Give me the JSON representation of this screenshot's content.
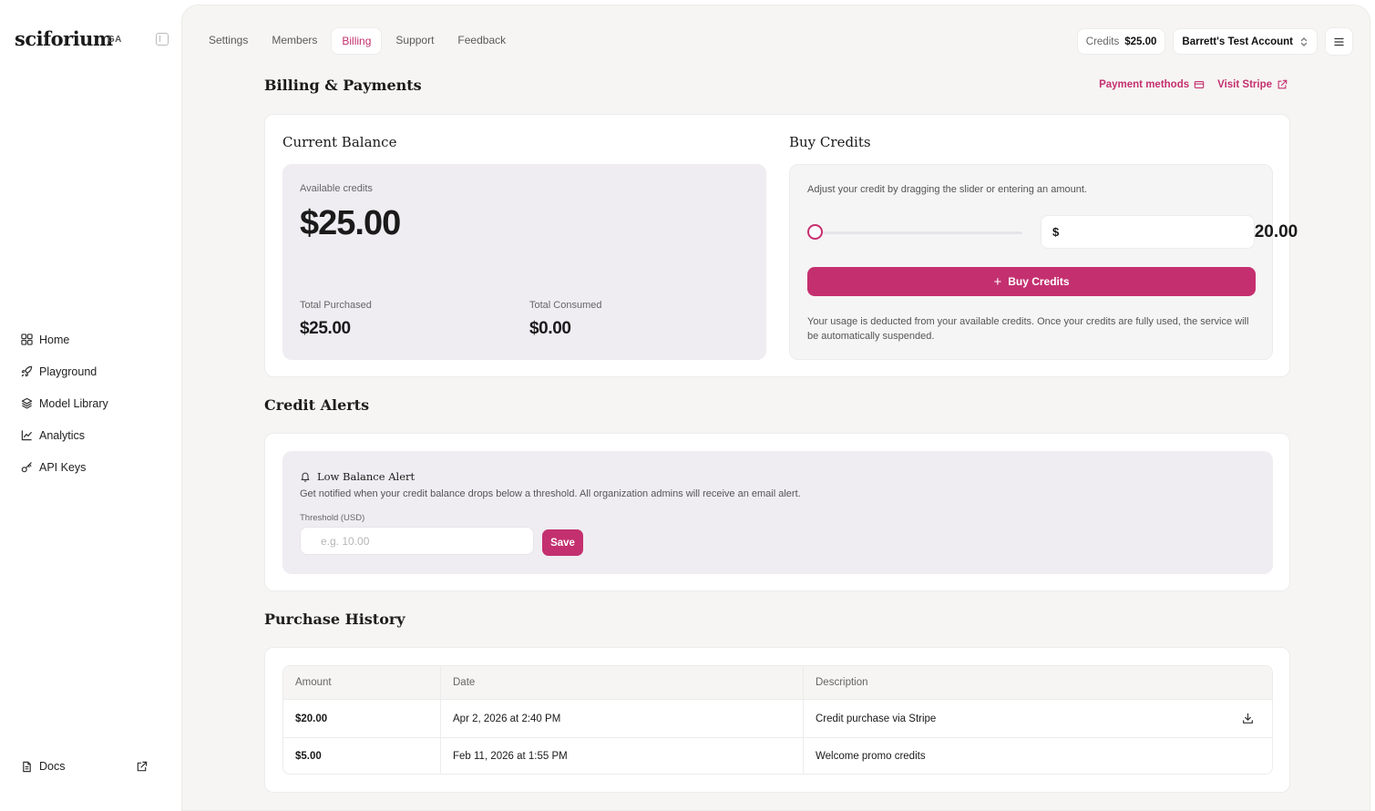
{
  "sidebar": {
    "brand": "sciforium",
    "brand_tag": "GA",
    "items": [
      {
        "label": "Home",
        "icon": "grid-icon"
      },
      {
        "label": "Playground",
        "icon": "rocket-icon"
      },
      {
        "label": "Model Library",
        "icon": "layers-icon"
      },
      {
        "label": "Analytics",
        "icon": "chart-line-icon"
      },
      {
        "label": "API Keys",
        "icon": "key-icon"
      }
    ],
    "docs": "Docs"
  },
  "topbar": {
    "tabs": [
      {
        "label": "Settings",
        "active": false
      },
      {
        "label": "Members",
        "active": false
      },
      {
        "label": "Billing",
        "active": true
      },
      {
        "label": "Support",
        "active": false
      },
      {
        "label": "Feedback",
        "active": false
      }
    ],
    "credits_label": "Credits",
    "credits_value": "$25.00",
    "account": "Barrett's Test Account"
  },
  "page": {
    "title": "Billing & Payments",
    "payment_methods": "Payment methods",
    "visit_stripe": "Visit Stripe"
  },
  "balance": {
    "title": "Current Balance",
    "available_label": "Available credits",
    "available_value": "$25.00",
    "purchased_label": "Total Purchased",
    "purchased_value": "$25.00",
    "consumed_label": "Total Consumed",
    "consumed_value": "$0.00"
  },
  "buy": {
    "title": "Buy Credits",
    "description": "Adjust your credit by dragging the slider or entering an amount.",
    "currency": "$",
    "amount": "20.00",
    "slider_fraction": 0,
    "button": "Buy Credits",
    "note": "Your usage is deducted from your available credits. Once your credits are fully used, the service will be automatically suspended."
  },
  "alerts": {
    "section_title": "Credit Alerts",
    "title": "Low Balance Alert",
    "description": "Get notified when your credit balance drops below a threshold. All organization admins will receive an email alert.",
    "threshold_label": "Threshold (USD)",
    "threshold_placeholder": "e.g. 10.00",
    "save": "Save"
  },
  "history": {
    "section_title": "Purchase History",
    "columns": [
      "Amount",
      "Date",
      "Description"
    ],
    "rows": [
      {
        "amount": "$20.00",
        "date": "Apr 2, 2026 at 2:40 PM",
        "description": "Credit purchase via Stripe",
        "download": true
      },
      {
        "amount": "$5.00",
        "date": "Feb 11, 2026 at 1:55 PM",
        "description": "Welcome promo credits",
        "download": false
      }
    ]
  },
  "colors": {
    "accent": "#c4306f",
    "panel": "#efedf2",
    "background": "#f6f5f3"
  }
}
